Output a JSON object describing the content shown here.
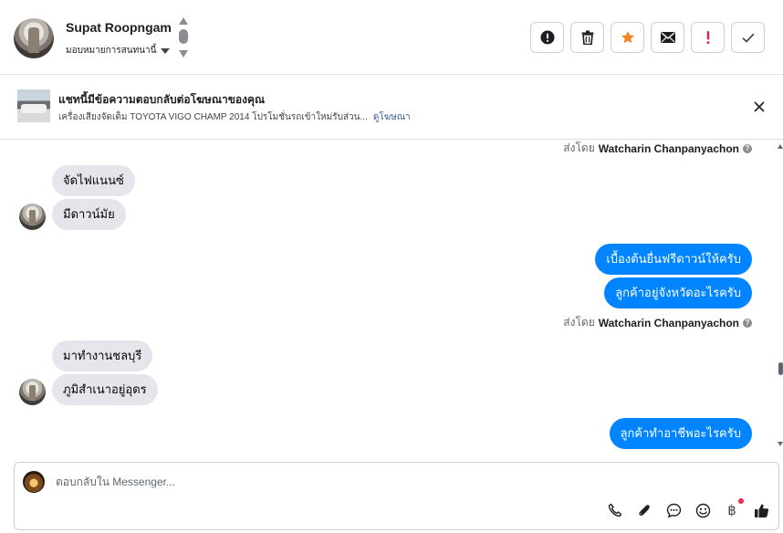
{
  "header": {
    "contact_name": "Supat Roopngam",
    "assign_label": "มอบหมายการสนทนานี้",
    "actions": [
      {
        "name": "spam-alert",
        "icon": "alert-circle-icon"
      },
      {
        "name": "delete",
        "icon": "trash-icon"
      },
      {
        "name": "star",
        "icon": "star-icon",
        "color": "#f5821f"
      },
      {
        "name": "mark-unread",
        "icon": "envelope-icon"
      },
      {
        "name": "follow-up",
        "icon": "exclamation-icon",
        "color": "#e41e3f"
      },
      {
        "name": "done",
        "icon": "check-icon"
      }
    ]
  },
  "ad": {
    "title": "แชทนี้มีข้อความตอบกลับต่อโฆษณาของคุณ",
    "subtitle": "เครื่องเสียงจัดเต็ม TOYOTA VIGO CHAMP 2014 โปรโมชั่นรถเข้าใหม่รับส่วน...",
    "link": "ดูโฆษณา"
  },
  "conversation": {
    "sent_by_prefix": "ส่งโดย",
    "agent_name": "Watcharin Chanpanyachon",
    "info_icon": "?",
    "messages": [
      {
        "direction": "in",
        "text": "จัดไฟแนนซ์"
      },
      {
        "direction": "in",
        "text": "มีดาวน์มัย"
      },
      {
        "direction": "out",
        "text": "เบื้องต้นยื่นฟรีดาวน์ให้ครับ"
      },
      {
        "direction": "out",
        "text": "ลูกค้าอยู่จังหวัดอะไรครับ"
      },
      {
        "direction": "in",
        "text": "มาทำงานชลบุรี"
      },
      {
        "direction": "in",
        "text": "ภูมิสำเนาอยู่อุดร"
      },
      {
        "direction": "out",
        "text": "ลูกค้าทำอาชีพอะไรครับ"
      }
    ]
  },
  "composer": {
    "placeholder": "ตอบกลับใน Messenger...",
    "value": "",
    "tools": [
      "phone-icon",
      "paperclip-icon",
      "chat-bubble-icon",
      "emoji-icon",
      "baht-icon",
      "thumbs-up-icon"
    ],
    "baht_symbol": "฿",
    "accent": "#1c1e21"
  },
  "colors": {
    "outgoing_bubble": "#0084ff",
    "incoming_bubble": "#e4e6eb",
    "notification_dot": "#f02849"
  }
}
